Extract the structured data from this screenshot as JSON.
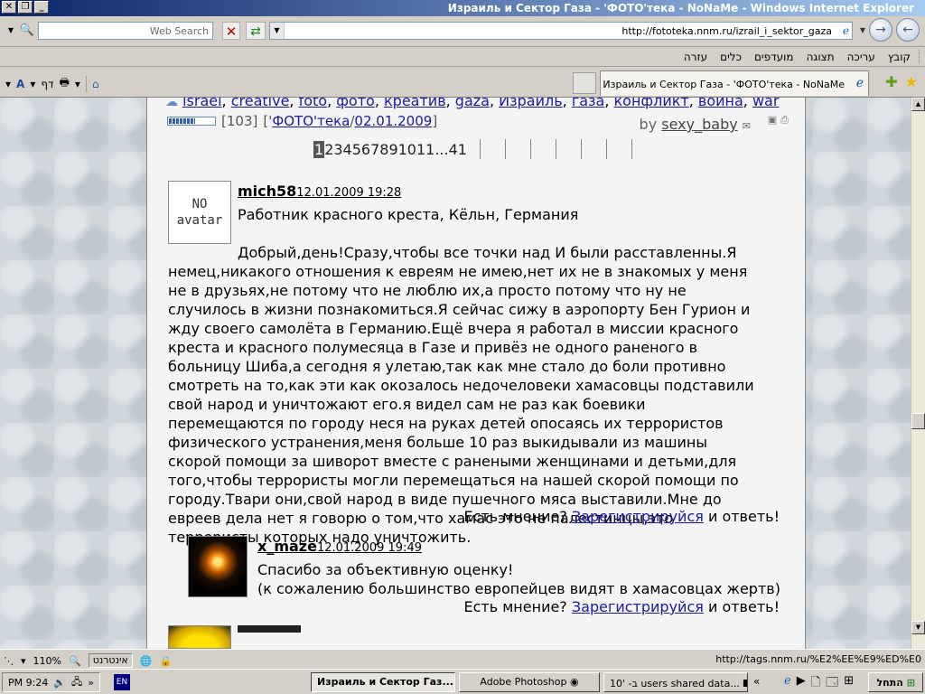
{
  "window": {
    "title": "Израиль и Сектор Газа - 'ФОТО'тека - NoNaMe - Windows Internet Explorer"
  },
  "address_bar": {
    "search_placeholder": "Web Search",
    "url": "http://fototeka.nnm.ru/izrail_i_sektor_gaza"
  },
  "menu": {
    "items": [
      "קובץ",
      "עריכה",
      "תצוגה",
      "מועדפים",
      "כלים",
      "עזרה"
    ]
  },
  "toolbar": {
    "left_label": "דף",
    "tab_label": "Израиль и Сектор Газа - 'ФОТО'тека - NoNaMe"
  },
  "post": {
    "tags": [
      "israel",
      "creative",
      "foto",
      "фото",
      "креатив",
      "gaza",
      "Израиль",
      "газа",
      "конфликт",
      "война",
      "war"
    ],
    "rating_fill": 0.55,
    "count": "[103]",
    "section_prefix": "['",
    "section": "ФОТО'тека",
    "section_sep": "/",
    "date": "02.01.2009",
    "section_suffix": "]",
    "by_label": "by",
    "author": "sexy_baby"
  },
  "pager": {
    "current": "1",
    "rest": "234567891011...41"
  },
  "comments": [
    {
      "author": "mich58",
      "timestamp": "12.01.2009 19:28",
      "avatar_text_1": "NO",
      "avatar_text_2": "avatar",
      "subtitle": "Работник красного креста, Кёльн, Германия",
      "body": "Добрый,день!Сразу,чтобы все точки над И были расставленны.Я немец,никакого отношения к евреям не имею,нет их не в знакомых у меня не в друзьях,не потому что не люблю их,а просто потому что ну не случилось в жизни познакомиться.Я сейчас сижу в аэропорту Бен Гурион и жду своего самолёта в Германию.Ещё вчера я работал в миссии красного креста и красного полумесяца в Газе и привёз не одного раненого в больницу Шиба,а сегодня я улетаю,так как мне стало до боли противно смотреть на то,как эти как окозалось недочеловеки хамасовцы подставили свой народ и уничтожают его.я видел сам не раз как боевики перемещаются по городу неся на руках детей опосаясь их террористов физического устранения,меня больше 10 раз выкидывали из машины скорой помощи за шиворот вместе с ранеными женщинами и детьми,для того,чтобы террористы могли перемещаться на нашей скорой помощи по городу.Твари они,свой народ в виде пушечного мяса выставили.Мне до евреев дела нет я говорю о том,что хамас это не палестинцы,это террористы которых надо уничтожить.",
      "reply_prefix": "Есть мнение? ",
      "reply_link": "Зарегистрируйся",
      "reply_suffix": " и ответь!"
    },
    {
      "author": "x_maze",
      "timestamp": "12.01.2009 19:49",
      "body_1": "Спасибо за объективную оценку!",
      "body_2": "(к сожалению большинство европейцев видят в хамасовцах жертв)",
      "reply_prefix": "Есть мнение? ",
      "reply_link": "Зарегистрируйся",
      "reply_suffix": " и ответь!"
    }
  ],
  "statusbar": {
    "zoom": "110%",
    "zone": "אינטרנט",
    "status_url": "http://tags.nnm.ru/%E2%EE%E9%ED%E0"
  },
  "taskbar": {
    "clock": "PM 9:24",
    "lang": "EN",
    "tasks": [
      {
        "label": "Израиль и Сектор Газ...",
        "active": true
      },
      {
        "label": "Adobe Photoshop",
        "active": false
      },
      {
        "label": "10' -ב users shared data...",
        "active": false
      }
    ],
    "start_label": "התחל"
  },
  "colors": {
    "link": "#1a1aa6",
    "titlebar_start": "#0a246a",
    "titlebar_end": "#a6caf0"
  }
}
